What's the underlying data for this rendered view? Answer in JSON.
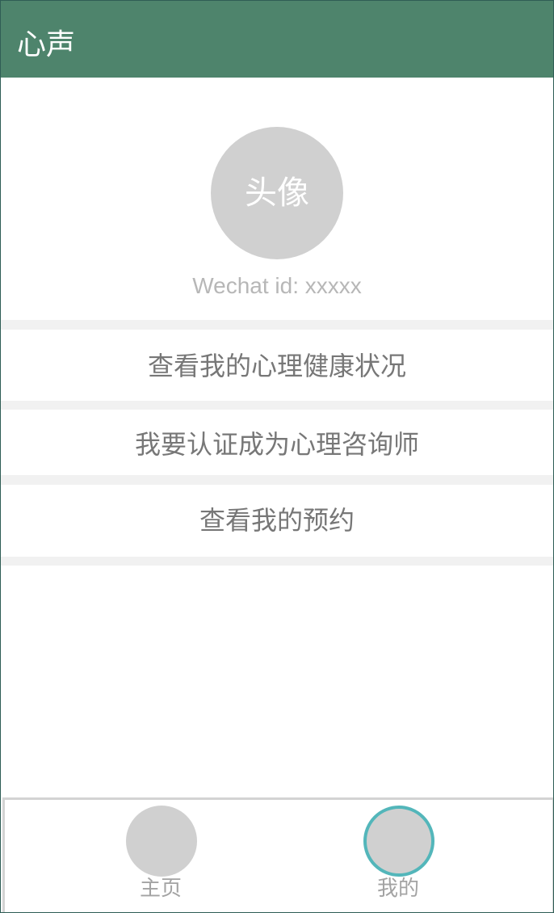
{
  "app": {
    "title": "心声"
  },
  "profile": {
    "avatar_placeholder": "头像",
    "wechat_id": "Wechat id: xxxxx"
  },
  "menu": {
    "items": [
      {
        "label": "查看我的心理健康状况"
      },
      {
        "label": "我要认证成为心理咨询师"
      },
      {
        "label": "查看我的预约"
      }
    ]
  },
  "tabbar": {
    "tabs": [
      {
        "label": "主页",
        "icon": "home-icon",
        "active": false
      },
      {
        "label": "我的",
        "icon": "profile-icon",
        "active": true
      }
    ]
  },
  "colors": {
    "header_bg": "#4e846c",
    "tab_active_ring": "#53b6ba",
    "placeholder_gray": "#d0d0d0"
  }
}
